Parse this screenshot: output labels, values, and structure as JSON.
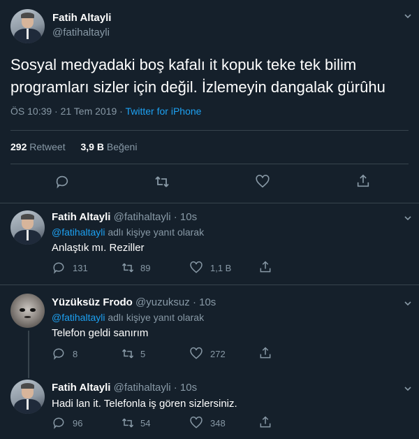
{
  "main_tweet": {
    "name": "Fatih Altayli",
    "handle": "@fatihaltayli",
    "text": "Sosyal medyadaki boş kafalı it kopuk teke tek bilim programları sizler için değil. İzlemeyin dangalak gürûhu",
    "time": "ÖS 10:39 · 21 Tem 2019 · ",
    "source": "Twitter for iPhone",
    "retweets_count": "292",
    "retweets_label": "Retweet",
    "likes_count": "3,9 B",
    "likes_label": "Beğeni"
  },
  "replies": [
    {
      "name": "Fatih Altayli",
      "handle": "@fatihaltayli",
      "age": "10s",
      "reply_to_handle": "@fatihaltayli",
      "reply_to_suffix": "adlı kişiye yanıt olarak",
      "text": "Anlaştık mı. Reziller",
      "replies": "131",
      "retweets": "89",
      "likes": "1,1 B"
    },
    {
      "name": "Yüzüksüz Frodo",
      "handle": "@yuzuksuz",
      "age": "10s",
      "reply_to_handle": "@fatihaltayli",
      "reply_to_suffix": "adlı kişiye yanıt olarak",
      "text": "Telefon geldi sanırım",
      "replies": "8",
      "retweets": "5",
      "likes": "272"
    },
    {
      "name": "Fatih Altayli",
      "handle": "@fatihaltayli",
      "age": "10s",
      "text": "Hadi lan it. Telefonla iş gören sizlersiniz.",
      "replies": "96",
      "retweets": "54",
      "likes": "348"
    }
  ],
  "colors": {
    "background": "#15202b",
    "text": "#ffffff",
    "muted": "#8899a6",
    "link": "#1da1f2",
    "divider": "#38444d"
  },
  "icons": [
    "chevron-down-icon",
    "reply-icon",
    "retweet-icon",
    "like-icon",
    "share-icon"
  ]
}
